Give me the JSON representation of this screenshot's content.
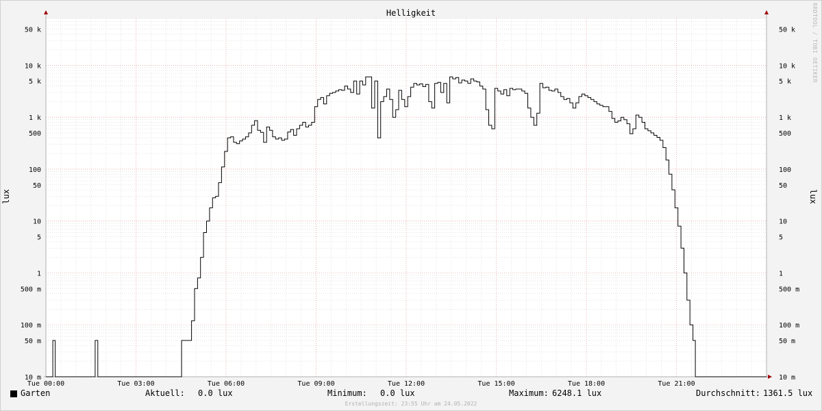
{
  "chart_data": {
    "type": "line",
    "title": "Helligkeit",
    "ylabel": "lux",
    "yscale": "log",
    "ylim": [
      0.01,
      80000
    ],
    "xlim_hours": [
      0,
      24
    ],
    "grid": true,
    "y_ticks": [
      {
        "value": 50000,
        "label": "50 k"
      },
      {
        "value": 10000,
        "label": "10 k"
      },
      {
        "value": 5000,
        "label": "5 k"
      },
      {
        "value": 1000,
        "label": "1 k"
      },
      {
        "value": 500,
        "label": "500"
      },
      {
        "value": 100,
        "label": "100"
      },
      {
        "value": 50,
        "label": "50"
      },
      {
        "value": 10,
        "label": "10"
      },
      {
        "value": 5,
        "label": "5"
      },
      {
        "value": 1,
        "label": "1"
      },
      {
        "value": 0.5,
        "label": "500 m"
      },
      {
        "value": 0.1,
        "label": "100 m"
      },
      {
        "value": 0.05,
        "label": "50 m"
      },
      {
        "value": 0.01,
        "label": "10 m"
      }
    ],
    "x_ticks": [
      {
        "value": 0,
        "label": "Tue 00:00"
      },
      {
        "value": 3,
        "label": "Tue 03:00"
      },
      {
        "value": 6,
        "label": "Tue 06:00"
      },
      {
        "value": 9,
        "label": "Tue 09:00"
      },
      {
        "value": 12,
        "label": "Tue 12:00"
      },
      {
        "value": 15,
        "label": "Tue 15:00"
      },
      {
        "value": 18,
        "label": "Tue 18:00"
      },
      {
        "value": 21,
        "label": "Tue 21:00"
      }
    ],
    "series": [
      {
        "name": "Garten",
        "color": "#000000",
        "points": [
          [
            0.0,
            0.01
          ],
          [
            0.22,
            0.01
          ],
          [
            0.23,
            0.05
          ],
          [
            0.3,
            0.05
          ],
          [
            0.31,
            0.01
          ],
          [
            1.63,
            0.01
          ],
          [
            1.64,
            0.05
          ],
          [
            1.72,
            0.05
          ],
          [
            1.73,
            0.01
          ],
          [
            4.5,
            0.01
          ],
          [
            4.52,
            0.05
          ],
          [
            4.75,
            0.05
          ],
          [
            4.85,
            0.12
          ],
          [
            4.95,
            0.5
          ],
          [
            5.05,
            0.8
          ],
          [
            5.15,
            2
          ],
          [
            5.25,
            6
          ],
          [
            5.35,
            10
          ],
          [
            5.45,
            18
          ],
          [
            5.55,
            28
          ],
          [
            5.65,
            30
          ],
          [
            5.75,
            55
          ],
          [
            5.85,
            110
          ],
          [
            5.95,
            220
          ],
          [
            6.05,
            400
          ],
          [
            6.15,
            420
          ],
          [
            6.25,
            330
          ],
          [
            6.35,
            310
          ],
          [
            6.45,
            350
          ],
          [
            6.55,
            380
          ],
          [
            6.65,
            420
          ],
          [
            6.75,
            500
          ],
          [
            6.85,
            700
          ],
          [
            6.95,
            860
          ],
          [
            7.05,
            560
          ],
          [
            7.15,
            510
          ],
          [
            7.25,
            330
          ],
          [
            7.35,
            650
          ],
          [
            7.45,
            560
          ],
          [
            7.55,
            420
          ],
          [
            7.65,
            380
          ],
          [
            7.75,
            400
          ],
          [
            7.85,
            360
          ],
          [
            7.95,
            380
          ],
          [
            8.05,
            520
          ],
          [
            8.15,
            580
          ],
          [
            8.25,
            450
          ],
          [
            8.35,
            600
          ],
          [
            8.45,
            700
          ],
          [
            8.55,
            800
          ],
          [
            8.65,
            650
          ],
          [
            8.75,
            700
          ],
          [
            8.85,
            800
          ],
          [
            8.95,
            1600
          ],
          [
            9.05,
            2200
          ],
          [
            9.15,
            2400
          ],
          [
            9.25,
            1800
          ],
          [
            9.35,
            2600
          ],
          [
            9.45,
            2900
          ],
          [
            9.55,
            3000
          ],
          [
            9.65,
            3200
          ],
          [
            9.75,
            3400
          ],
          [
            9.85,
            3300
          ],
          [
            9.95,
            4000
          ],
          [
            10.05,
            3500
          ],
          [
            10.15,
            3000
          ],
          [
            10.25,
            5000
          ],
          [
            10.35,
            2800
          ],
          [
            10.45,
            5000
          ],
          [
            10.55,
            4200
          ],
          [
            10.65,
            6000
          ],
          [
            10.75,
            6000
          ],
          [
            10.85,
            1500
          ],
          [
            10.95,
            5000
          ],
          [
            11.05,
            400
          ],
          [
            11.15,
            2000
          ],
          [
            11.25,
            2500
          ],
          [
            11.35,
            3500
          ],
          [
            11.45,
            2200
          ],
          [
            11.55,
            1000
          ],
          [
            11.65,
            1400
          ],
          [
            11.75,
            3300
          ],
          [
            11.85,
            2200
          ],
          [
            11.95,
            1600
          ],
          [
            12.05,
            2500
          ],
          [
            12.15,
            3800
          ],
          [
            12.25,
            4500
          ],
          [
            12.35,
            4200
          ],
          [
            12.45,
            4400
          ],
          [
            12.55,
            3900
          ],
          [
            12.65,
            4300
          ],
          [
            12.75,
            2000
          ],
          [
            12.85,
            1500
          ],
          [
            12.95,
            4500
          ],
          [
            13.05,
            4700
          ],
          [
            13.15,
            3000
          ],
          [
            13.25,
            4500
          ],
          [
            13.35,
            1900
          ],
          [
            13.45,
            6000
          ],
          [
            13.55,
            5500
          ],
          [
            13.65,
            5800
          ],
          [
            13.75,
            4600
          ],
          [
            13.85,
            5200
          ],
          [
            13.95,
            5000
          ],
          [
            14.05,
            4500
          ],
          [
            14.15,
            5500
          ],
          [
            14.25,
            5000
          ],
          [
            14.35,
            4800
          ],
          [
            14.45,
            4000
          ],
          [
            14.55,
            3500
          ],
          [
            14.65,
            1400
          ],
          [
            14.75,
            700
          ],
          [
            14.85,
            600
          ],
          [
            14.95,
            3600
          ],
          [
            15.05,
            3200
          ],
          [
            15.15,
            2800
          ],
          [
            15.25,
            3400
          ],
          [
            15.35,
            2600
          ],
          [
            15.45,
            3600
          ],
          [
            15.55,
            3400
          ],
          [
            15.65,
            3500
          ],
          [
            15.75,
            3500
          ],
          [
            15.85,
            3200
          ],
          [
            15.95,
            2900
          ],
          [
            16.05,
            1500
          ],
          [
            16.15,
            1000
          ],
          [
            16.25,
            700
          ],
          [
            16.35,
            1200
          ],
          [
            16.45,
            4500
          ],
          [
            16.55,
            3700
          ],
          [
            16.65,
            3800
          ],
          [
            16.75,
            3300
          ],
          [
            16.85,
            3200
          ],
          [
            16.95,
            3500
          ],
          [
            17.05,
            3000
          ],
          [
            17.15,
            2500
          ],
          [
            17.25,
            2200
          ],
          [
            17.35,
            2300
          ],
          [
            17.45,
            1900
          ],
          [
            17.55,
            1500
          ],
          [
            17.65,
            1900
          ],
          [
            17.75,
            2500
          ],
          [
            17.85,
            2800
          ],
          [
            17.95,
            2600
          ],
          [
            18.05,
            2400
          ],
          [
            18.15,
            2200
          ],
          [
            18.25,
            2000
          ],
          [
            18.35,
            1800
          ],
          [
            18.45,
            1700
          ],
          [
            18.55,
            1600
          ],
          [
            18.65,
            1600
          ],
          [
            18.75,
            1300
          ],
          [
            18.85,
            950
          ],
          [
            18.95,
            800
          ],
          [
            19.05,
            850
          ],
          [
            19.15,
            1000
          ],
          [
            19.25,
            900
          ],
          [
            19.35,
            750
          ],
          [
            19.45,
            480
          ],
          [
            19.55,
            600
          ],
          [
            19.65,
            1100
          ],
          [
            19.75,
            1000
          ],
          [
            19.85,
            800
          ],
          [
            19.95,
            600
          ],
          [
            20.05,
            550
          ],
          [
            20.15,
            500
          ],
          [
            20.25,
            450
          ],
          [
            20.35,
            410
          ],
          [
            20.45,
            360
          ],
          [
            20.55,
            260
          ],
          [
            20.65,
            150
          ],
          [
            20.75,
            80
          ],
          [
            20.85,
            40
          ],
          [
            20.95,
            18
          ],
          [
            21.05,
            8
          ],
          [
            21.15,
            3
          ],
          [
            21.25,
            1
          ],
          [
            21.35,
            0.3
          ],
          [
            21.45,
            0.1
          ],
          [
            21.55,
            0.05
          ],
          [
            21.62,
            0.05
          ],
          [
            21.63,
            0.01
          ],
          [
            24.0,
            0.01
          ]
        ]
      }
    ]
  },
  "legend": {
    "series_name": "Garten",
    "current_label": "Aktuell:",
    "current_value": "0.0 lux",
    "min_label": "Minimum:",
    "min_value": "0.0 lux",
    "max_label": "Maximum:",
    "max_value": "6248.1 lux",
    "avg_label": "Durchschnitt:",
    "avg_value": "1361.5 lux"
  },
  "footer": "Erstellungszeit: 23:55 Uhr am 24.05.2022",
  "watermark": "RRDTOOL / TOBI OETIKER",
  "colors": {
    "background": "#f3f3f3",
    "plot_background": "#ffffff",
    "minor_grid": "#dddddd",
    "major_grid": "#e8a0a0",
    "axis": "#b0b0b0",
    "arrow": "#a00000",
    "line": "#000000"
  }
}
